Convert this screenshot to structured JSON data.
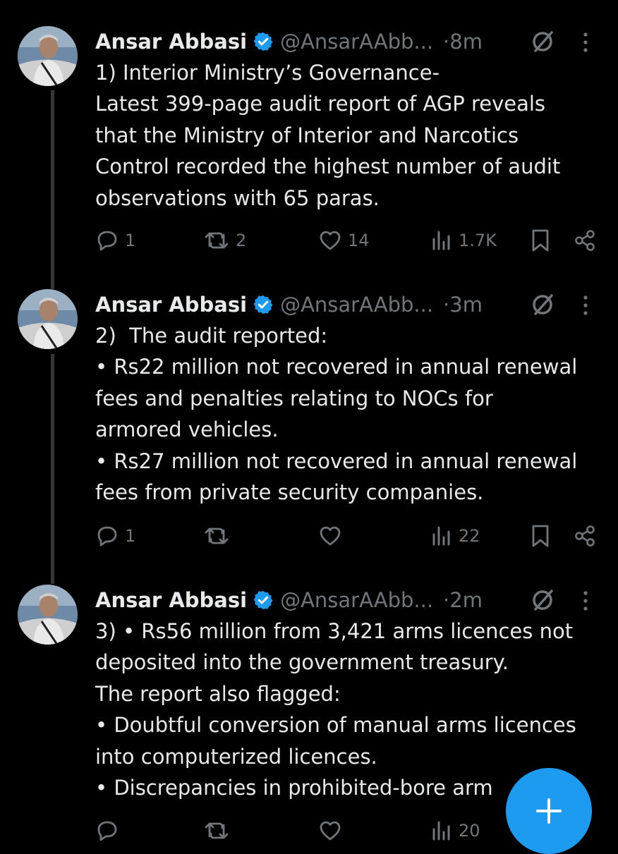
{
  "tweets": [
    {
      "author": "Ansar Abbasi",
      "handle": "@AnsarAAbb...",
      "time": "·8m",
      "lines": [
        "1) Interior Ministry’s Governance-",
        "Latest 399-page audit report of AGP reveals",
        "that the Ministry of Interior and Narcotics",
        "Control recorded the highest number of audit",
        "observations with 65 paras."
      ],
      "stats": {
        "replies": "1",
        "reposts": "2",
        "likes": "14",
        "views": "1.7K"
      }
    },
    {
      "author": "Ansar Abbasi",
      "handle": "@AnsarAAbb...",
      "time": "·3m",
      "lines": [
        "2)  The audit reported:",
        "• Rs22 million not recovered in annual renewal",
        "fees and penalties relating to NOCs for",
        "armored vehicles.",
        "• Rs27 million not recovered in annual renewal",
        "fees from private security companies."
      ],
      "stats": {
        "replies": "1",
        "reposts": "",
        "likes": "",
        "views": "22"
      }
    },
    {
      "author": "Ansar Abbasi",
      "handle": "@AnsarAAbb...",
      "time": "·2m",
      "lines": [
        "3) • Rs56 million from 3,421 arms licences not",
        "deposited into the government treasury.",
        "The report also flagged:",
        "• Doubtful conversion of manual arms licences",
        "into computerized licences.",
        "• Discrepancies in prohibited-bore arm"
      ],
      "stats": {
        "replies": "",
        "reposts": "",
        "likes": "",
        "views": "20"
      }
    }
  ],
  "icons": {
    "reply": "reply-icon",
    "repost": "repost-icon",
    "like": "heart-icon",
    "views": "views-icon",
    "bookmark": "bookmark-icon",
    "share": "share-icon",
    "mute": "mute-icon",
    "more": "more-icon",
    "compose": "plus-icon"
  },
  "colors": {
    "background": "#000000",
    "accent": "#1d9bf0",
    "muted": "#71767b",
    "text": "#e7e9ea"
  }
}
